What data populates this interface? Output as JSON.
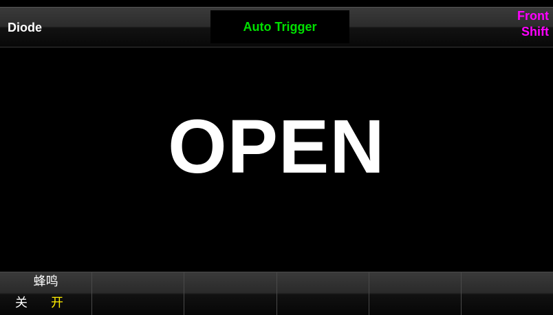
{
  "header": {
    "mode": "Diode",
    "trigger": "Auto Trigger",
    "panel": "Front",
    "shift": "Shift"
  },
  "display": {
    "reading": "OPEN"
  },
  "softkeys": [
    {
      "title": "蜂鸣",
      "options": {
        "off": "关",
        "on": "开"
      },
      "selected": "on"
    },
    {
      "title": ""
    },
    {
      "title": ""
    },
    {
      "title": ""
    },
    {
      "title": ""
    },
    {
      "title": ""
    }
  ],
  "colors": {
    "trigger": "#00e000",
    "panel_flags": "#ff00ff",
    "selected_option": "#ffee00",
    "reading": "#ffffff",
    "background": "#000000"
  }
}
